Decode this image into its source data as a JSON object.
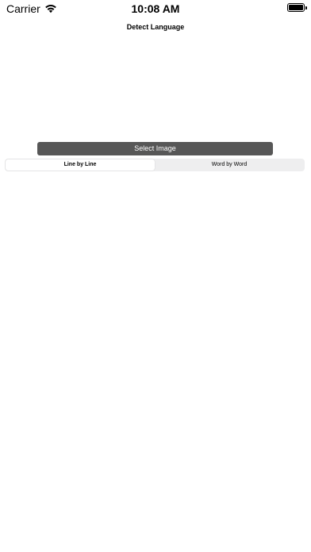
{
  "status_bar": {
    "carrier": "Carrier",
    "time": "10:08 AM",
    "wifi_icon": "wifi-icon",
    "battery_icon": "battery-icon"
  },
  "nav": {
    "title": "Detect Language"
  },
  "main": {
    "select_image_label": "Select Image",
    "segments": [
      {
        "label": "Line by Line",
        "selected": true
      },
      {
        "label": "Word by Word",
        "selected": false
      }
    ]
  },
  "colors": {
    "button_bg": "#575757",
    "button_text": "#ffffff",
    "segment_bg": "#eeeeef"
  }
}
